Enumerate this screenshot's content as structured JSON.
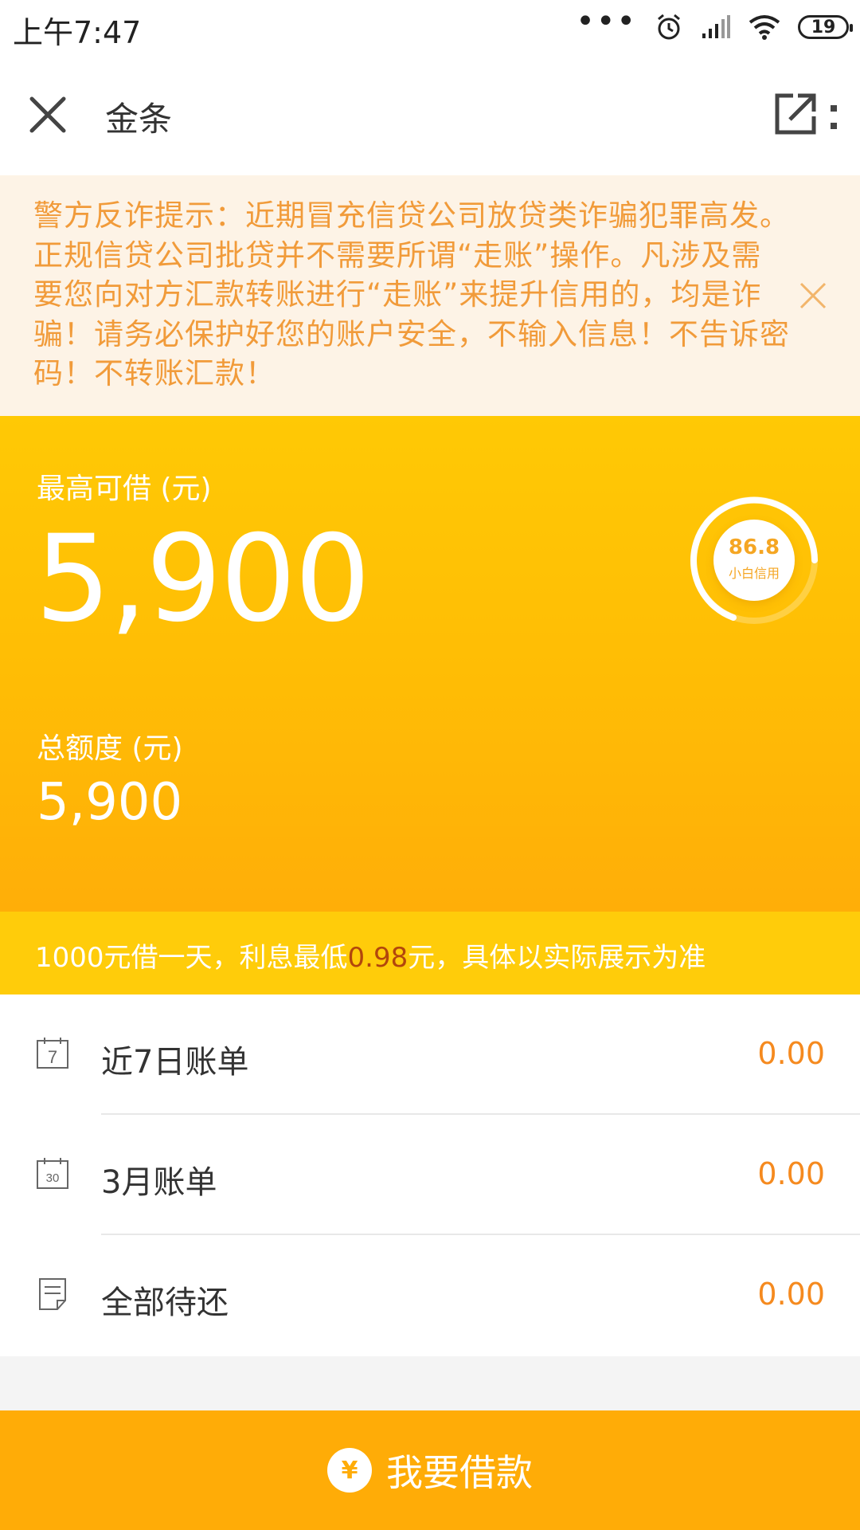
{
  "status_bar": {
    "time": "上午7:47",
    "battery": "19",
    "icons": [
      "more-dots-icon",
      "alarm-icon",
      "signal-icon",
      "wifi-icon",
      "battery-icon"
    ]
  },
  "nav": {
    "title": "金条",
    "close_icon": "close-icon",
    "share_icon": "share-icon",
    "more_icon": "more-vertical-icon"
  },
  "warning": {
    "text": "警方反诈提示：近期冒充信贷公司放贷类诈骗犯罪高发。正规信贷公司批贷并不需要所谓“走账”操作。凡涉及需要您向对方汇款转账进行“走账”来提升信用的，均是诈骗！请务必保护好您的账户安全，不输入信息！不告诉密码！不转账汇款！",
    "color": "#f19b3a"
  },
  "credit": {
    "max_label": "最高可借 (元)",
    "max_value": "5,900",
    "total_label": "总额度 (元)",
    "total_value": "5,900",
    "score_value": "86.8",
    "score_label": "小白信用"
  },
  "interest": {
    "prefix": "1000元借一天，利息最低",
    "highlight": "0.98",
    "suffix": "元，具体以实际展示为准"
  },
  "bills": [
    {
      "icon": "calendar-7-icon",
      "label": "近7日账单",
      "amount": "0.00"
    },
    {
      "icon": "calendar-30-icon",
      "label": "3月账单",
      "amount": "0.00"
    },
    {
      "icon": "document-icon",
      "label": "全部待还",
      "amount": "0.00"
    }
  ],
  "borrow": {
    "icon": "yen-icon",
    "label": "我要借款",
    "symbol": "¥"
  },
  "colors": {
    "accent": "#ffac07",
    "amount": "#f58a1f",
    "highlight": "#b2460c"
  }
}
